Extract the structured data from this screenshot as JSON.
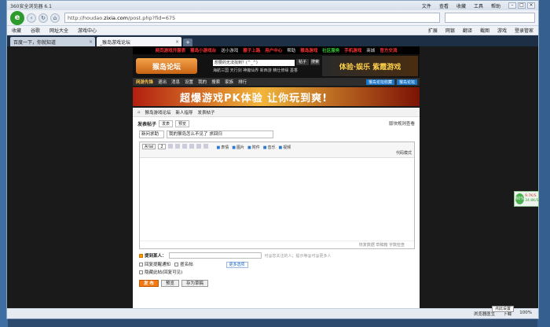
{
  "browser": {
    "title": "360安全浏览器 6.1",
    "menus": [
      "文件",
      "查看",
      "收藏",
      "工具",
      "帮助"
    ],
    "url_prefix": "http://houdao.",
    "url_host": "zixia.com",
    "url_suffix": "/post.php?fid=675",
    "bookmarks": [
      "收藏",
      "谷歌",
      "网址大全",
      "游戏中心"
    ],
    "bookmarks_right": [
      "扩展",
      "网银",
      "翻译",
      "截图",
      "游戏",
      "登录管家"
    ],
    "tabs": [
      "百度一下，你就知道",
      "_猴岛游戏论坛"
    ],
    "new_tab": "+"
  },
  "site": {
    "topnav": [
      "网页游戏开服表",
      "猴岛小游戏台",
      "送小游戏",
      "猴子上路",
      "用户中心",
      "帮助",
      "猴岛游戏",
      "社区服务",
      "手机游戏",
      "商城",
      "官方交流"
    ],
    "logo": "猴岛论坛",
    "search_placeholder": "想要的无法找到？(^_^)",
    "search_btn": "帖子",
    "search_btn2": "搜索",
    "search_links": "海航三国   天行剑   神魔仙界   新西游   精仕修缘   墨香",
    "header_banner": "体验·娱乐  紫霞游戏",
    "menubar_hi": "网游先锋",
    "menubar": [
      "退出",
      "消息",
      "设置",
      "我的",
      "搜索",
      "家族",
      "排行"
    ],
    "menubar_right": [
      "猴岛论坛收藏",
      "猴岛论坛"
    ],
    "ad_banner": "超爆游戏PK体验 让你玩到爽!"
  },
  "post": {
    "breadcrumbs": [
      "猴岛游戏论坛",
      "新人指导",
      "发表帖子"
    ],
    "heading": "发表帖子",
    "mode_tabs": [
      "发表",
      "预览"
    ],
    "rules_link": "版块规则查看",
    "subject_type": "新问求助",
    "subject": "我的猴岛怎么不见了 求回归",
    "font_select": "Arial",
    "size_select": "2",
    "media": [
      "表情",
      "图片",
      "附件",
      "音乐",
      "视频"
    ],
    "code_mode": "代码模式",
    "editor_footer": "恢复数据   草稿箱   字数检查",
    "notify_label": "提到某人：",
    "notify_hint": "可@您关注的人；提示等@可@更多人",
    "options": [
      "回复提醒通知",
      "隐藏此帖(回复可见)"
    ],
    "anon_label": "匿名帖",
    "more_options": "更多选项",
    "submit": "发 布",
    "preview": "预览",
    "save_draft": "存为草稿"
  },
  "widget": {
    "percent": "60%",
    "up": "9.7K/S",
    "down": "34.8K/S"
  },
  "statusbar": {
    "left": "",
    "items": [
      "浏览器医生",
      "下载",
      "100%"
    ],
    "tray": "点此设置"
  }
}
